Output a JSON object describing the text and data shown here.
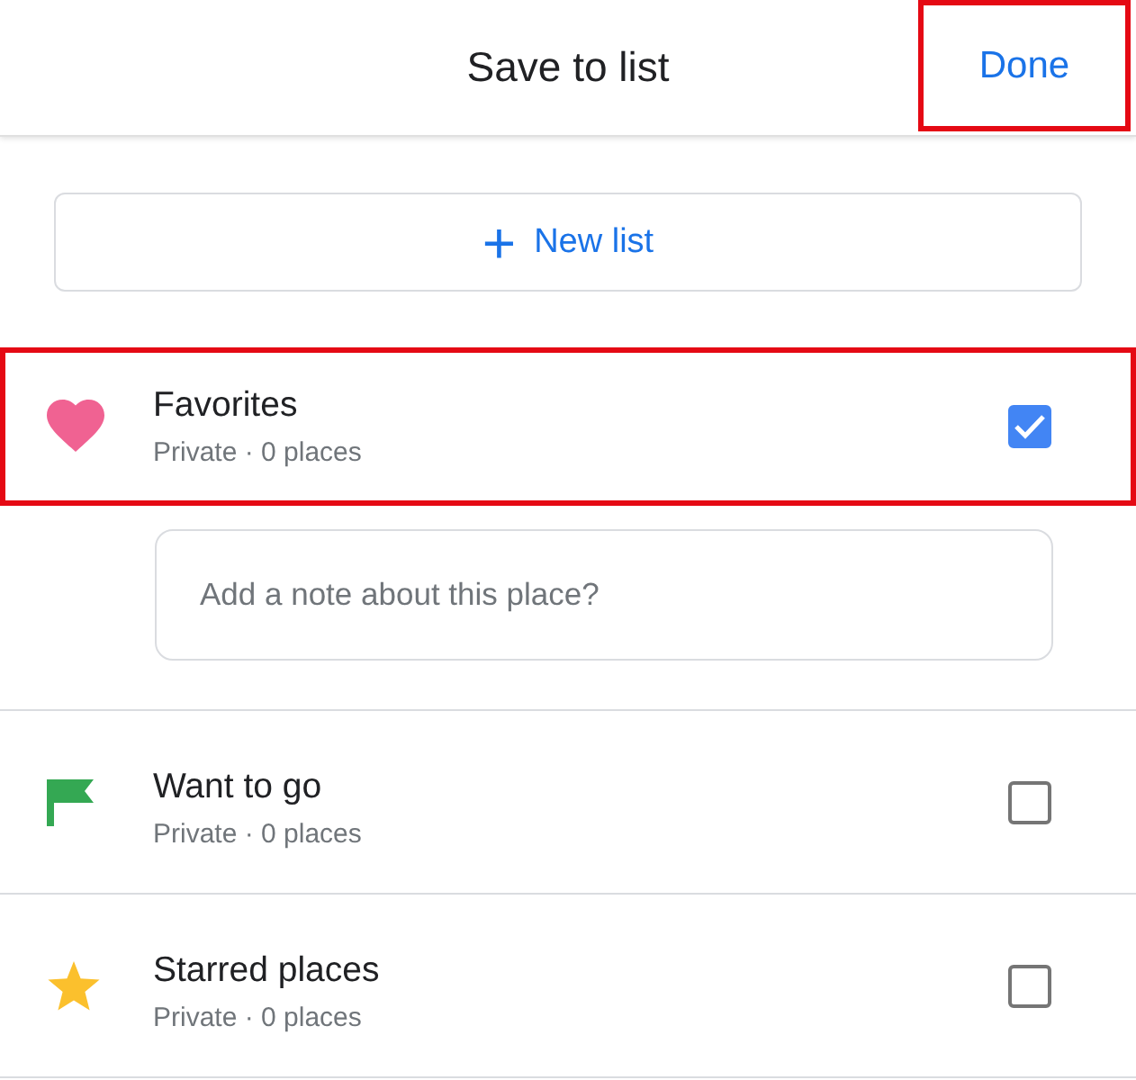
{
  "header": {
    "title": "Save to list",
    "done": {
      "label": "Done",
      "highlighted": true
    }
  },
  "new_list": {
    "icon": "+",
    "label": "New list"
  },
  "lists": [
    {
      "kind": "heart",
      "color": "#f06292",
      "name": "Favorites",
      "subtitle": "Private · 0 places",
      "checked": true,
      "highlighted": true,
      "note": {
        "placeholder": "Add a note about this place?"
      }
    },
    {
      "kind": "flag",
      "color": "#34a853",
      "name": "Want to go",
      "subtitle": "Private · 0 places",
      "checked": false,
      "highlighted": false
    },
    {
      "kind": "star",
      "color": "#fbc02d",
      "name": "Starred places",
      "subtitle": "Private · 0 places",
      "checked": false,
      "highlighted": false
    }
  ]
}
